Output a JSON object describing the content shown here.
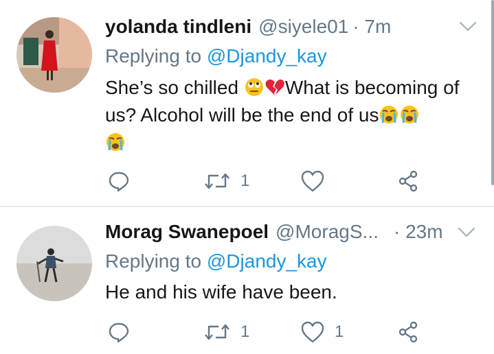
{
  "tweets": [
    {
      "name": "yolanda tindleni",
      "handle": "@siyele01",
      "time": "· 7m",
      "reply_prefix": "Replying to ",
      "reply_to": "@Djandy_kay",
      "text_part1": "She’s so chilled ",
      "text_part2": "What is becoming of us? Alcohol will be the end of us",
      "emojis": [
        "rolling-eyes-emoji",
        "broken-heart-emoji",
        "crying-face-emoji",
        "crying-face-emoji",
        "crying-face-emoji"
      ],
      "retweets": "1",
      "likes": ""
    },
    {
      "name": "Morag Swanepoel",
      "handle": "@MoragS...",
      "time": "· 23m",
      "reply_prefix": "Replying to ",
      "reply_to": "@Djandy_kay",
      "text": "He and his wife have been.",
      "retweets": "1",
      "likes": "1"
    }
  ],
  "icons": {
    "reply": "reply-icon",
    "retweet": "retweet-icon",
    "like": "heart-icon",
    "share": "share-icon",
    "more": "chevron-down-icon"
  },
  "colors": {
    "text": "#14171a",
    "muted": "#657786",
    "link": "#1b95e0",
    "divider": "#e6ecf0"
  }
}
